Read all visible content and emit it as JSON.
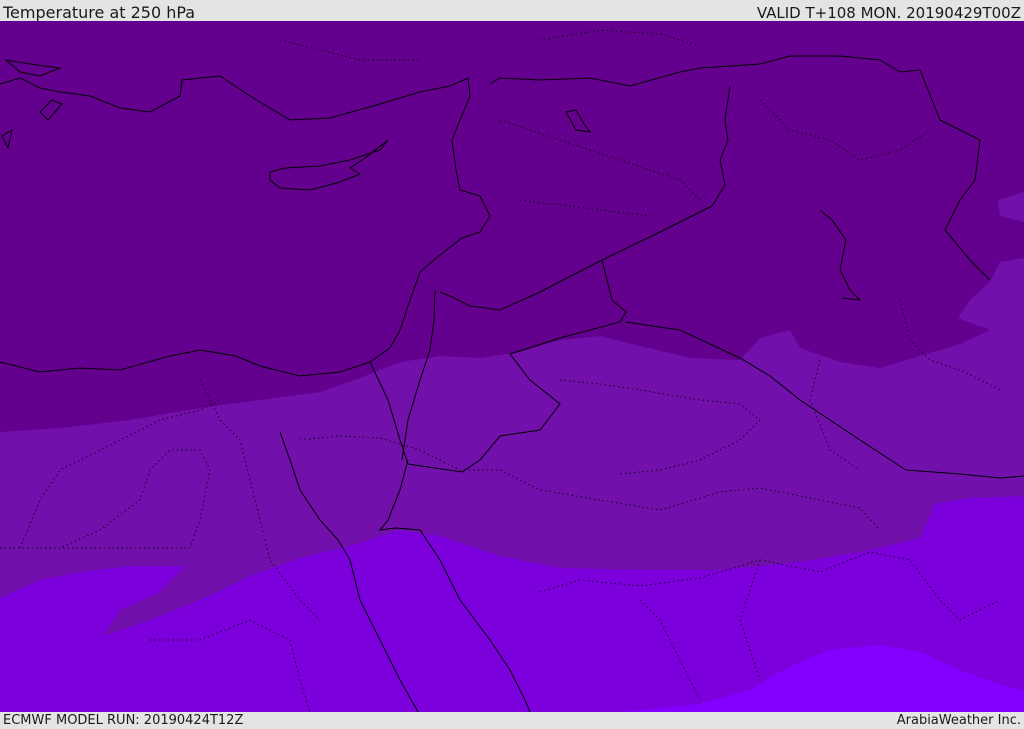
{
  "header": {
    "title": "Temperature at 250 hPa",
    "valid": "VALID T+108 MON. 20190429T00Z"
  },
  "footer": {
    "model_run": "ECMWF MODEL RUN: 20190424T12Z",
    "credit": "ArabiaWeather Inc."
  },
  "map": {
    "fill_colors": {
      "coldest": "#64008e",
      "cold": "#7110ab",
      "mild": "#7c00dc",
      "warm": "#8200ff"
    },
    "line_color": "#000000"
  }
}
